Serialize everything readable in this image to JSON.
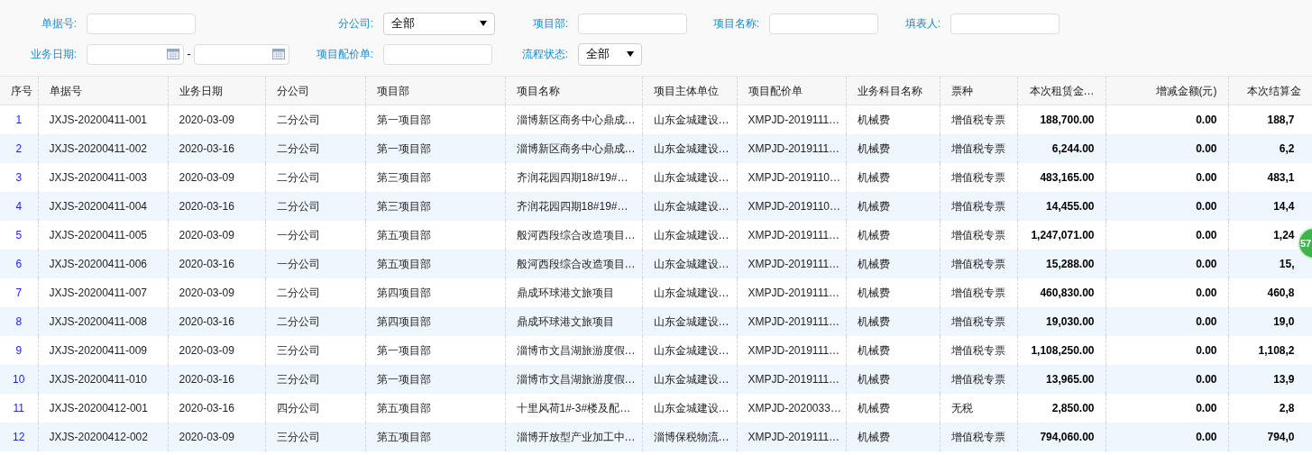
{
  "filter_rows": [
    [
      {
        "kind": "text",
        "label": "单据号:"
      },
      {
        "kind": "select",
        "label": "分公司:",
        "value": "全部"
      },
      {
        "kind": "text",
        "label": "项目部:"
      },
      {
        "kind": "text",
        "label": "项目名称:"
      },
      {
        "kind": "text",
        "label": "填表人:"
      }
    ],
    [
      {
        "kind": "date_range",
        "label": "业务日期:",
        "separator": "-"
      },
      {
        "kind": "text",
        "label": "项目配价单:"
      },
      {
        "kind": "select",
        "label": "流程状态:",
        "value": "全部"
      }
    ]
  ],
  "table": {
    "columns": [
      {
        "label": "序号",
        "kind": "index"
      },
      {
        "label": "单据号",
        "kind": "text"
      },
      {
        "label": "业务日期",
        "kind": "text"
      },
      {
        "label": "分公司",
        "kind": "text"
      },
      {
        "label": "项目部",
        "kind": "text"
      },
      {
        "label": "项目名称",
        "kind": "text"
      },
      {
        "label": "项目主体单位",
        "kind": "text"
      },
      {
        "label": "项目配价单",
        "kind": "text"
      },
      {
        "label": "业务科目名称",
        "kind": "text"
      },
      {
        "label": "票种",
        "kind": "text"
      },
      {
        "label": "本次租赁金…",
        "kind": "amount"
      },
      {
        "label": "增减金额(元)",
        "kind": "amount"
      },
      {
        "label": "本次结算金",
        "kind": "amount"
      }
    ],
    "rows": [
      [
        "1",
        "JXJS-20200411-001",
        "2020-03-09",
        "二分公司",
        "第一项目部",
        "淄博新区商务中心鼎成…",
        "山东金城建设…",
        "XMPJD-2019111…",
        "机械费",
        "增值税专票",
        "188,700.00",
        "0.00",
        "188,7"
      ],
      [
        "2",
        "JXJS-20200411-002",
        "2020-03-16",
        "二分公司",
        "第一项目部",
        "淄博新区商务中心鼎成…",
        "山东金城建设…",
        "XMPJD-2019111…",
        "机械费",
        "增值税专票",
        "6,244.00",
        "0.00",
        "6,2"
      ],
      [
        "3",
        "JXJS-20200411-003",
        "2020-03-09",
        "二分公司",
        "第三项目部",
        "齐润花园四期18#19#…",
        "山东金城建设…",
        "XMPJD-2019110…",
        "机械费",
        "增值税专票",
        "483,165.00",
        "0.00",
        "483,1"
      ],
      [
        "4",
        "JXJS-20200411-004",
        "2020-03-16",
        "二分公司",
        "第三项目部",
        "齐润花园四期18#19#…",
        "山东金城建设…",
        "XMPJD-2019110…",
        "机械费",
        "增值税专票",
        "14,455.00",
        "0.00",
        "14,4"
      ],
      [
        "5",
        "JXJS-20200411-005",
        "2020-03-09",
        "一分公司",
        "第五项目部",
        "般河西段综合改造项目…",
        "山东金城建设…",
        "XMPJD-2019111…",
        "机械费",
        "增值税专票",
        "1,247,071.00",
        "0.00",
        "1,24"
      ],
      [
        "6",
        "JXJS-20200411-006",
        "2020-03-16",
        "一分公司",
        "第五项目部",
        "般河西段综合改造项目…",
        "山东金城建设…",
        "XMPJD-2019111…",
        "机械费",
        "增值税专票",
        "15,288.00",
        "0.00",
        "15,"
      ],
      [
        "7",
        "JXJS-20200411-007",
        "2020-03-09",
        "二分公司",
        "第四项目部",
        "鼎成环球港文旅项目",
        "山东金城建设…",
        "XMPJD-2019111…",
        "机械费",
        "增值税专票",
        "460,830.00",
        "0.00",
        "460,8"
      ],
      [
        "8",
        "JXJS-20200411-008",
        "2020-03-16",
        "二分公司",
        "第四项目部",
        "鼎成环球港文旅项目",
        "山东金城建设…",
        "XMPJD-2019111…",
        "机械费",
        "增值税专票",
        "19,030.00",
        "0.00",
        "19,0"
      ],
      [
        "9",
        "JXJS-20200411-009",
        "2020-03-09",
        "三分公司",
        "第一项目部",
        "淄博市文昌湖旅游度假…",
        "山东金城建设…",
        "XMPJD-2019111…",
        "机械费",
        "增值税专票",
        "1,108,250.00",
        "0.00",
        "1,108,2"
      ],
      [
        "10",
        "JXJS-20200411-010",
        "2020-03-16",
        "三分公司",
        "第一项目部",
        "淄博市文昌湖旅游度假…",
        "山东金城建设…",
        "XMPJD-2019111…",
        "机械费",
        "增值税专票",
        "13,965.00",
        "0.00",
        "13,9"
      ],
      [
        "11",
        "JXJS-20200412-001",
        "2020-03-16",
        "四分公司",
        "第五项目部",
        "十里风荷1#-3#楼及配…",
        "山东金城建设…",
        "XMPJD-2020033…",
        "机械费",
        "无税",
        "2,850.00",
        "0.00",
        "2,8"
      ],
      [
        "12",
        "JXJS-20200412-002",
        "2020-03-09",
        "三分公司",
        "第五项目部",
        "淄博开放型产业加工中…",
        "淄博保税物流…",
        "XMPJD-2019111…",
        "机械费",
        "增值税专票",
        "794,060.00",
        "0.00",
        "794,0"
      ]
    ]
  },
  "floating_badge": {
    "text": "57"
  }
}
